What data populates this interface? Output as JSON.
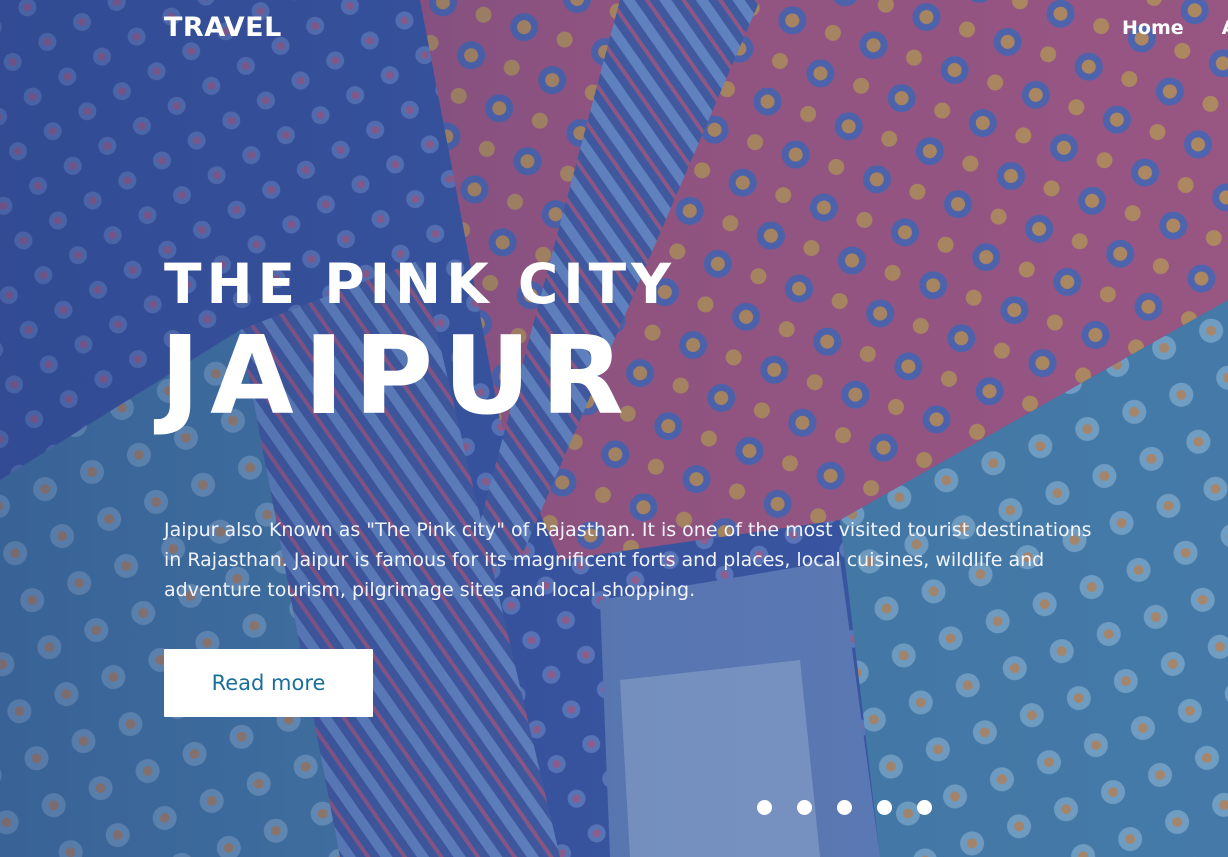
{
  "nav": {
    "brand": "TRAVEL",
    "links": [
      "Home",
      "A"
    ]
  },
  "hero": {
    "subtitle": "THE PINK CITY",
    "title": "JAIPUR",
    "description": "Jaipur also Known as \"The Pink city\" of Rajasthan. It is one of the most visited tourist destinations in Rajasthan. Jaipur is famous for its magnificent forts and places, local cuisines, wildlife and adventure tourism, pilgrimage sites and local shopping.",
    "button_label": "Read more"
  },
  "slider": {
    "dot_count": 5
  },
  "colors": {
    "overlay": "#3b5597",
    "button_text": "#1b6e9a"
  }
}
